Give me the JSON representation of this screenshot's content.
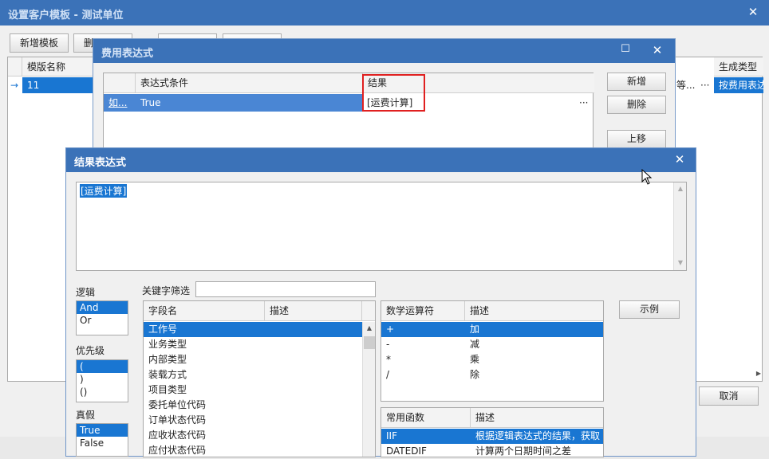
{
  "main_window": {
    "title": "设置客户模板 - 测试单位",
    "close": "✕",
    "toolbar": {
      "add": "新增模板",
      "del": "删"
    },
    "grid": {
      "col1": "模版名称",
      "row_marker": "→",
      "row1": "11",
      "right_header": "生成类型",
      "right_value": "按费用表达",
      "mid_partial": "等...",
      "ellipsis": "···"
    },
    "cancel": "取消"
  },
  "expr_dialog": {
    "title": "费用表达式",
    "max": "☐",
    "close": "✕",
    "grid": {
      "col_condition": "表达式条件",
      "col_result": "结果",
      "row_edit": "如...",
      "row_condition": "True",
      "row_result": "[运费计算]",
      "ellipsis": "···"
    },
    "buttons": {
      "add": "新增",
      "del": "删除",
      "up": "上移"
    }
  },
  "result_dialog": {
    "title": "结果表达式",
    "close": "✕",
    "expression": "[运费计算]",
    "logic_label": "逻辑",
    "logic_items": [
      "And",
      "Or"
    ],
    "priority_label": "优先级",
    "priority_items": [
      "(",
      ")",
      "()"
    ],
    "bool_label": "真假",
    "bool_items": [
      "True",
      "False"
    ],
    "keyword_label": "关键字筛选",
    "keyword_value": "",
    "fields": {
      "col_name": "字段名",
      "col_desc": "描述",
      "rows": [
        "工作号",
        "业务类型",
        "内部类型",
        "装载方式",
        "项目类型",
        "委托单位代码",
        "订单状态代码",
        "应收状态代码",
        "应付状态代码"
      ]
    },
    "math": {
      "col_op": "数学运算符",
      "col_desc": "描述",
      "rows": [
        {
          "op": "+",
          "desc": "加"
        },
        {
          "op": "-",
          "desc": "减"
        },
        {
          "op": "*",
          "desc": "乘"
        },
        {
          "op": "/",
          "desc": "除"
        }
      ]
    },
    "funcs": {
      "col_name": "常用函数",
      "col_desc": "描述",
      "rows": [
        {
          "name": "IIF",
          "desc": "根据逻辑表达式的结果，获取"
        },
        {
          "name": "DATEDIF",
          "desc": "计算两个日期时间之差"
        }
      ]
    },
    "example_btn": "示例"
  }
}
